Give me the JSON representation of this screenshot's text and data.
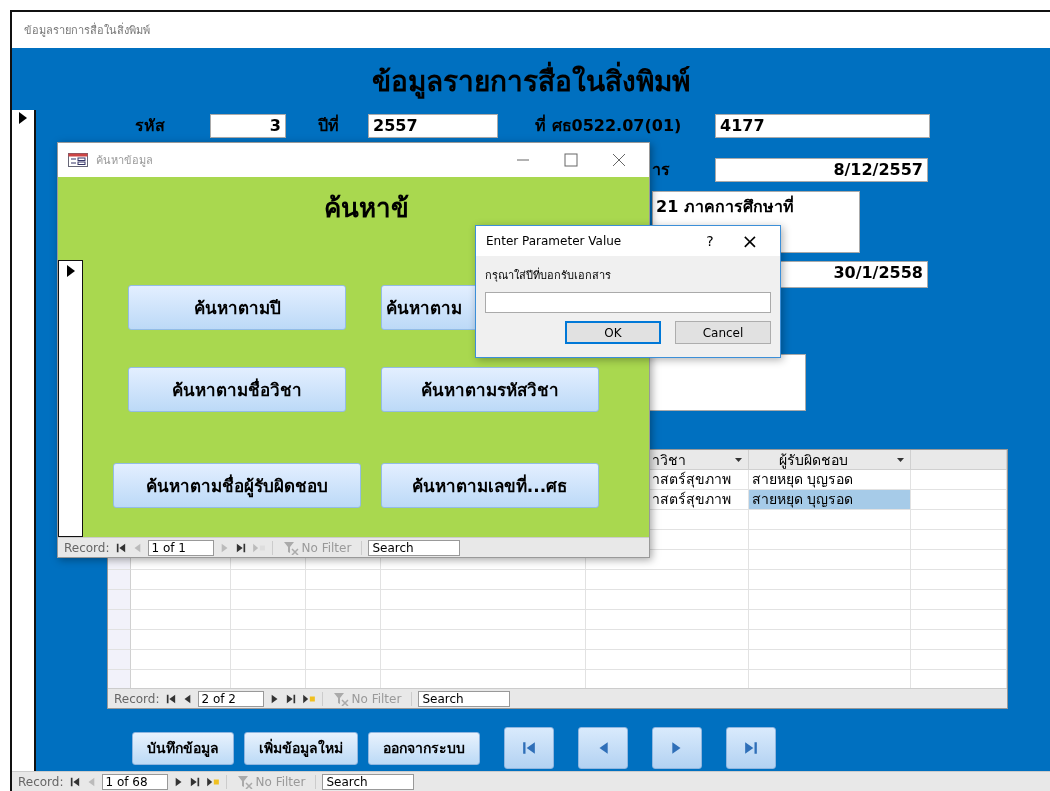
{
  "window": {
    "title": "ข้อมูลรายการสื่อในสิ่งพิมพ์"
  },
  "form": {
    "heading": "ข้อมูลรายการสื่อในสิ่งพิมพ์",
    "row_1": [
      {
        "label": "รหัส",
        "value": "3"
      },
      {
        "label": "ปีที่",
        "value": "2557"
      },
      {
        "label": "ที่ ศธ0522.07(01)",
        "value": "4177"
      }
    ],
    "row_2": {
      "label": "าร",
      "value": "8/12/2557"
    },
    "memo": "21 ภาคการศึกษาที่",
    "date_2": {
      "value": "30/1/2558"
    },
    "datasheet": {
      "columns": [
        {
          "label": "าวิชา"
        },
        {
          "label": "ผู้รับผิดชอบ"
        }
      ],
      "rows": [
        {
          "cells": [
            {
              "text": "าสตร์สุขภาพ",
              "selected": false
            },
            {
              "text": "สายหยุด บุญรอด",
              "selected": false
            }
          ]
        },
        {
          "cells": [
            {
              "text": "าสตร์สุขภาพ",
              "selected": false
            },
            {
              "text": "สายหยุด บุญรอด",
              "selected": true
            }
          ]
        }
      ],
      "record_bar": {
        "label": "Record:",
        "position": "2 of 2",
        "filter": "No Filter",
        "search": "Search",
        "buttons": [
          {
            "kind": "first",
            "disabled": false
          },
          {
            "kind": "prev",
            "disabled": false
          },
          {
            "kind": "next",
            "disabled": false
          },
          {
            "kind": "last",
            "disabled": false
          },
          {
            "kind": "new",
            "disabled": false
          }
        ]
      }
    },
    "buttons": [
      "บันทึกข้อมูล",
      "เพิ่มข้อมูลใหม่",
      "ออกจากระบบ"
    ],
    "nav_buttons": [
      {
        "kind": "first"
      },
      {
        "kind": "prev"
      },
      {
        "kind": "next"
      },
      {
        "kind": "last"
      }
    ]
  },
  "record_bar": {
    "label": "Record:",
    "position": "1 of 68",
    "filter": "No Filter",
    "search": "Search",
    "buttons": [
      {
        "kind": "first",
        "disabled": false
      },
      {
        "kind": "prev",
        "disabled": true
      },
      {
        "kind": "next",
        "disabled": false
      },
      {
        "kind": "last",
        "disabled": false
      },
      {
        "kind": "new",
        "disabled": false
      }
    ]
  },
  "search_window": {
    "title": "ค้นหาข้อมูล",
    "heading": "ค้นหาข้",
    "buttons": [
      "ค้นหาตามปี",
      "ค้นหาตาม",
      "ค้นหาตามชื่อวิชา",
      "ค้นหาตามรหัสวิชา",
      "ค้นหาตามชื่อผู้รับผิดชอบ",
      "ค้นหาตามเลขที่...ศธ"
    ],
    "record_bar": {
      "label": "Record:",
      "position": "1 of 1",
      "filter": "No Filter",
      "search": "Search",
      "buttons": [
        {
          "kind": "first",
          "disabled": false
        },
        {
          "kind": "prev",
          "disabled": true
        },
        {
          "kind": "next",
          "disabled": true
        },
        {
          "kind": "last",
          "disabled": false
        },
        {
          "kind": "new",
          "disabled": true
        }
      ]
    }
  },
  "dialog": {
    "title": "Enter Parameter Value",
    "help": "?",
    "close": "×",
    "prompt": "กรุณาใส่ปีที่บอกรับเอกสาร",
    "ok": "OK",
    "cancel": "Cancel"
  }
}
